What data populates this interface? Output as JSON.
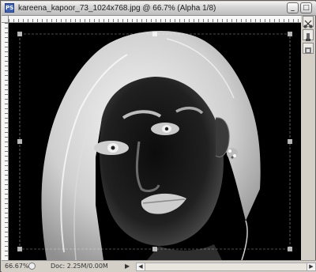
{
  "window": {
    "title": "kareena_kapoor_73_1024x768.jpg @ 66.7% (Alpha 1/8)",
    "app_icon": "PS",
    "minimize_label": "_",
    "maximize_label": "□"
  },
  "side_tools": [
    "scissors-icon",
    "dropper-icon",
    "brush-icon"
  ],
  "canvas": {
    "image_description_icon": "inverted-portrait"
  },
  "status": {
    "zoom": "66.67%",
    "doc": "Doc: 2.25M/0.00M",
    "arrow": "▶"
  },
  "colors": {
    "frame": "#d4d0c8",
    "canvas_bg": "#000000"
  }
}
